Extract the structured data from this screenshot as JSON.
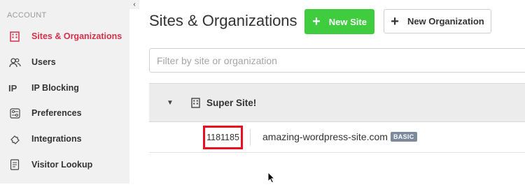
{
  "sidebar": {
    "section_header": "ACCOUNT",
    "items": [
      {
        "label": "Sites & Organizations",
        "icon": "building-icon",
        "active": true
      },
      {
        "label": "Users",
        "icon": "users-icon",
        "active": false
      },
      {
        "label": "IP Blocking",
        "icon": "ip-icon",
        "active": false
      },
      {
        "label": "Preferences",
        "icon": "preferences-icon",
        "active": false
      },
      {
        "label": "Integrations",
        "icon": "puzzle-icon",
        "active": false
      },
      {
        "label": "Visitor Lookup",
        "icon": "visitor-lookup-icon",
        "active": false
      }
    ],
    "collapse_glyph": "‹"
  },
  "header": {
    "title": "Sites & Organizations",
    "new_site_label": "New Site",
    "new_org_label": "New Organization"
  },
  "filter": {
    "placeholder": "Filter by site or organization",
    "value": ""
  },
  "group": {
    "name": "Super Site!",
    "expanded": true,
    "sites": [
      {
        "id": "1181185",
        "domain": "amazing-wordpress-site.com",
        "plan": "BASIC"
      }
    ]
  },
  "colors": {
    "accent_red": "#d6304a",
    "primary_green": "#3fcc3f",
    "highlight_box": "#e8101e",
    "badge": "#7d8a9e"
  }
}
